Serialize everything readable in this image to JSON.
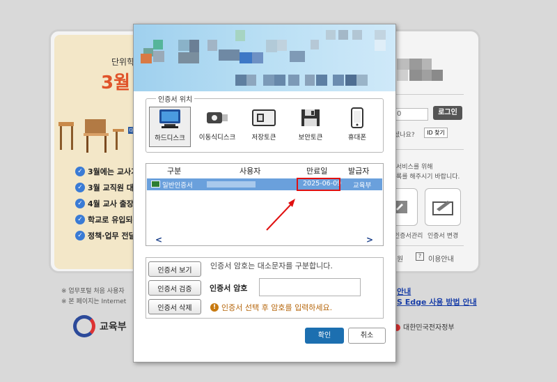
{
  "background": {
    "banner_line1": "단위학",
    "banner_line2": "3월",
    "notices": [
      "3월에는 교사가",
      "3월 교직원 대상",
      "4월 교사 출장인",
      "학교로 유입되는",
      "정책·업무 전달"
    ],
    "login_button": "로그인",
    "input_hint": "0",
    "forgot_text": "셨나요?",
    "id_find_button": "ID 찾기",
    "service_text_1": "서비스를 위해",
    "service_text_2": "록를 해주시기 바랍니다.",
    "tile_right_label": "인증서 변경",
    "tile_left_label": "인증서관리",
    "help_left": "원",
    "help_right": "이용안내",
    "help_icon": "?",
    "footnote_1": "※ 업무포털 처음 사용자",
    "footnote_2": "※ 본 페이지는 Internet",
    "link_1": "안내",
    "link_2": "S Edge 사용 방법 안내",
    "ministry_logo_text": "교육부",
    "egov_text": "대한민국전자정부"
  },
  "dialog": {
    "location_legend": "인증서 위치",
    "locations": [
      {
        "label": "하드디스크",
        "icon": "monitor-icon",
        "selected": true
      },
      {
        "label": "이동식디스크",
        "icon": "usb-icon",
        "selected": false
      },
      {
        "label": "저장토큰",
        "icon": "token-icon",
        "selected": false
      },
      {
        "label": "보안토큰",
        "icon": "floppy-icon",
        "selected": false
      },
      {
        "label": "휴대폰",
        "icon": "phone-icon",
        "selected": false
      }
    ],
    "table": {
      "headers": [
        "구분",
        "사용자",
        "만료일",
        "발급자"
      ],
      "rows": [
        {
          "type": "일반인증서",
          "user": "",
          "expiry": "2025-06-09",
          "issuer": "교육부",
          "selected": true
        }
      ],
      "scroll_left": "<",
      "scroll_right": ">"
    },
    "buttons": {
      "view": "인증서 보기",
      "verify": "인증서 검증",
      "delete": "인증서 삭제",
      "ok": "확인",
      "cancel": "취소"
    },
    "case_notice": "인증서 암호는 대소문자를 구분합니다.",
    "password_label": "인증서 암호",
    "password_value": "",
    "warning": "인증서 선택 후 암호를 입력하세요.",
    "warning_icon": "!"
  },
  "colors": {
    "selection": "#6aa0dc",
    "highlight_border": "#e01010",
    "ok_button": "#1c6fb0",
    "warning_text": "#b5650a"
  }
}
